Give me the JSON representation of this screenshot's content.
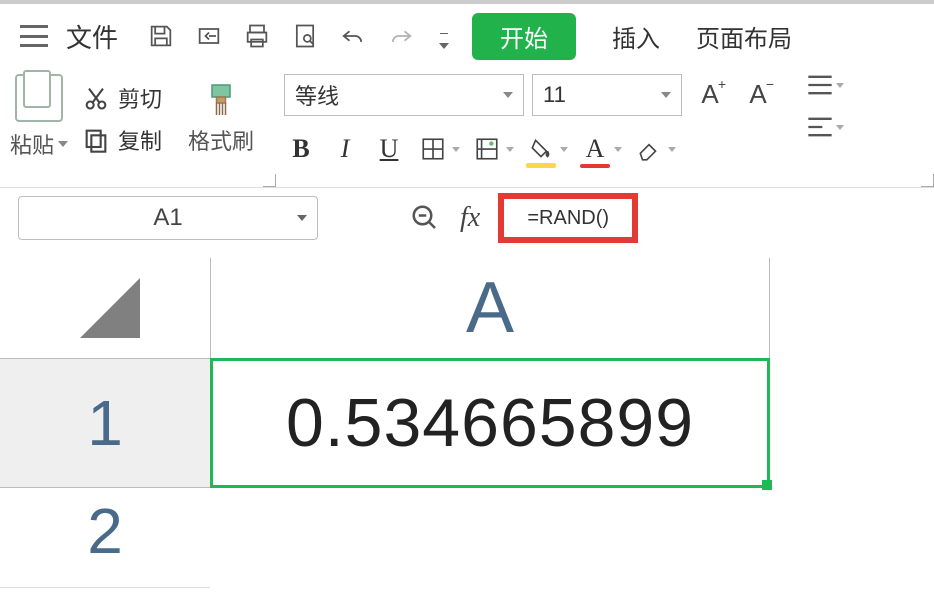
{
  "topbar": {
    "file_label": "文件",
    "start_tab": "开始",
    "insert_tab": "插入",
    "layout_tab": "页面布局"
  },
  "ribbon": {
    "paste_label": "粘贴",
    "cut_label": "剪切",
    "copy_label": "复制",
    "brush_label": "格式刷",
    "font_name": "等线",
    "font_size": "11"
  },
  "formula_bar": {
    "cell_ref": "A1",
    "formula": "=RAND()"
  },
  "sheet": {
    "col_a": "A",
    "row_1": "1",
    "row_2": "2",
    "cell_a1_value": "0.534665899"
  }
}
